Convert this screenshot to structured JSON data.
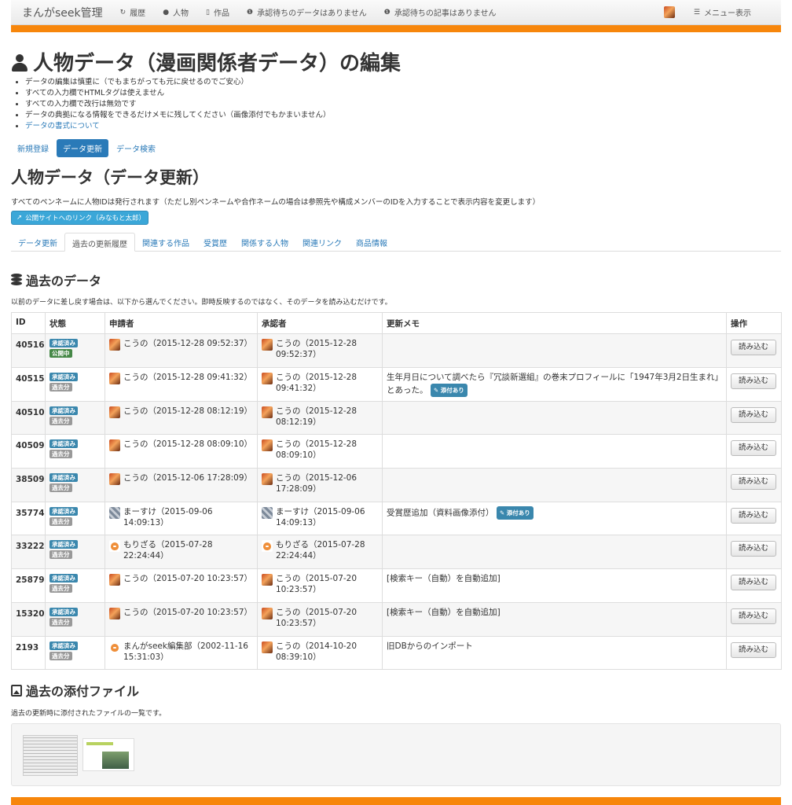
{
  "navbar": {
    "brand": "まんがseek管理",
    "items": [
      {
        "icon": "history-icon",
        "label": "履歴"
      },
      {
        "icon": "person-icon",
        "label": "人物"
      },
      {
        "icon": "file-icon",
        "label": "作品"
      },
      {
        "icon": "info-circle-icon",
        "label": "承認待ちのデータはありません"
      },
      {
        "icon": "info-circle-icon",
        "label": "承認待ちの記事はありません"
      }
    ],
    "menu_label": "メニュー表示"
  },
  "page": {
    "title": "人物データ（漫画関係者データ）の編集",
    "notes": [
      "データの編集は慎重に（でもまちがっても元に戻せるのでご安心）",
      "すべての入力欄でHTMLタグは使えません",
      "すべての入力欄で改行は無効です",
      "データの典拠になる情報をできるだけメモに残してください（画像添付でもかまいません）"
    ],
    "format_link": "データの書式について"
  },
  "subnav": [
    "新規登録",
    "データ更新",
    "データ検索"
  ],
  "section": {
    "title": "人物データ（データ更新）",
    "description": "すべてのペンネームに人物IDは発行されます（ただし別ペンネームや合作ネームの場合は参照先や構成メンバーのIDを入力することで表示内容を変更します）",
    "public_link": "公開サイトへのリンク（みなもと太郎）"
  },
  "tabs": [
    "データ更新",
    "過去の更新履歴",
    "関連する作品",
    "受賞歴",
    "関係する人物",
    "関連リンク",
    "商品情報"
  ],
  "history": {
    "title": "過去のデータ",
    "note": "以前のデータに差し戻す場合は、以下から選んでください。即時反映するのではなく、そのデータを読み込むだけです。",
    "columns": [
      "ID",
      "状態",
      "申請者",
      "承認者",
      "更新メモ",
      "操作"
    ],
    "read_label": "読み込む",
    "attach_label": "添付あり",
    "rows": [
      {
        "id": "40516",
        "status1": "承認済み",
        "status2": "公開中",
        "s2": "green",
        "req_av": "k",
        "requester": "こうの（2015-12-28 09:52:37）",
        "app_av": "k",
        "approver": "こうの（2015-12-28 09:52:37）",
        "memo": "",
        "attach": false
      },
      {
        "id": "40515",
        "status1": "承認済み",
        "status2": "過去分",
        "s2": "gray",
        "req_av": "k",
        "requester": "こうの（2015-12-28 09:41:32）",
        "app_av": "k",
        "approver": "こうの（2015-12-28 09:41:32）",
        "memo": "生年月日について調べたら『冗談新選組』の巻末プロフィールに「1947年3月2日生まれ」とあった。",
        "attach": true
      },
      {
        "id": "40510",
        "status1": "承認済み",
        "status2": "過去分",
        "s2": "gray",
        "req_av": "k",
        "requester": "こうの（2015-12-28 08:12:19）",
        "app_av": "k",
        "approver": "こうの（2015-12-28 08:12:19）",
        "memo": "",
        "attach": false
      },
      {
        "id": "40509",
        "status1": "承認済み",
        "status2": "過去分",
        "s2": "gray",
        "req_av": "k",
        "requester": "こうの（2015-12-28 08:09:10）",
        "app_av": "k",
        "approver": "こうの（2015-12-28 08:09:10）",
        "memo": "",
        "attach": false
      },
      {
        "id": "38509",
        "status1": "承認済み",
        "status2": "過去分",
        "s2": "gray",
        "req_av": "k",
        "requester": "こうの（2015-12-06 17:28:09）",
        "app_av": "k",
        "approver": "こうの（2015-12-06 17:28:09）",
        "memo": "",
        "attach": false
      },
      {
        "id": "35774",
        "status1": "承認済み",
        "status2": "過去分",
        "s2": "gray",
        "req_av": "m",
        "requester": "まーすけ（2015-09-06 14:09:13）",
        "app_av": "m",
        "approver": "まーすけ（2015-09-06 14:09:13）",
        "memo": "受賞歴追加（資料画像添付）",
        "attach": true
      },
      {
        "id": "33222",
        "status1": "承認済み",
        "status2": "過去分",
        "s2": "gray",
        "req_av": "r",
        "requester": "もりざる（2015-07-28 22:24:44）",
        "app_av": "r",
        "approver": "もりざる（2015-07-28 22:24:44）",
        "memo": "",
        "attach": false
      },
      {
        "id": "25879",
        "status1": "承認済み",
        "status2": "過去分",
        "s2": "gray",
        "req_av": "k",
        "requester": "こうの（2015-07-20 10:23:57）",
        "app_av": "k",
        "approver": "こうの（2015-07-20 10:23:57）",
        "memo": "[検索キー（自動）を自動追加]",
        "attach": false
      },
      {
        "id": "15320",
        "status1": "承認済み",
        "status2": "過去分",
        "s2": "gray",
        "req_av": "k",
        "requester": "こうの（2015-07-20 10:23:57）",
        "app_av": "k",
        "approver": "こうの（2015-07-20 10:23:57）",
        "memo": "[検索キー（自動）を自動追加]",
        "attach": false
      },
      {
        "id": "2193",
        "status1": "承認済み",
        "status2": "過去分",
        "s2": "gray",
        "req_av": "r",
        "requester": "まんがseek編集部（2002-11-16 15:31:03）",
        "app_av": "k",
        "approver": "こうの（2014-10-20 08:39:10）",
        "memo": "旧DBからのインポート",
        "attach": false
      }
    ]
  },
  "attachments": {
    "title": "過去の添付ファイル",
    "note": "過去の更新時に添付されたファイルの一覧です。"
  }
}
